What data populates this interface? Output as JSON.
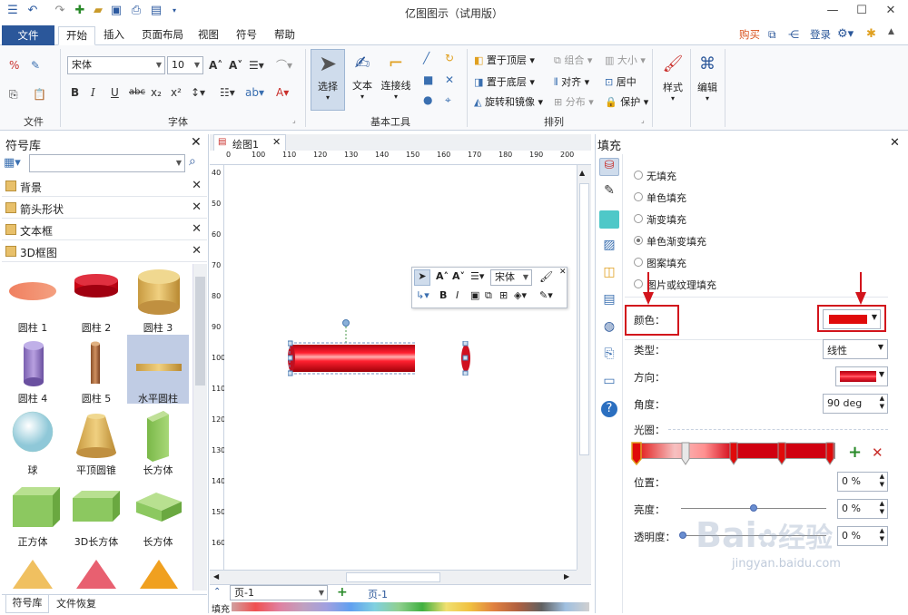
{
  "app": {
    "title": "亿图图示（试用版）"
  },
  "menu": {
    "file": "文件",
    "tabs": [
      "开始",
      "插入",
      "页面布局",
      "视图",
      "符号",
      "帮助"
    ],
    "buy": "购买",
    "login": "登录"
  },
  "ribbon": {
    "clipboard_label": "文件",
    "font_name": "宋体",
    "font_size": "10",
    "font_label": "字体",
    "tools": {
      "select": "选择",
      "text": "文本",
      "connector": "连接线",
      "label": "基本工具"
    },
    "arrange": {
      "bring_front": "置于顶层",
      "send_back": "置于底层",
      "rotate": "旋转和镜像",
      "group": "组合",
      "align": "对齐",
      "distribute": "分布",
      "size": "大小",
      "center": "居中",
      "protect": "保护",
      "label": "排列"
    },
    "style": "样式",
    "edit": "编辑"
  },
  "symlib": {
    "title": "符号库",
    "categories": [
      "背景",
      "箭头形状",
      "文本框",
      "3D框图"
    ],
    "shapes": [
      "圆柱 1",
      "圆柱 2",
      "圆柱 3",
      "圆柱 4",
      "圆柱 5",
      "水平圆柱",
      "球",
      "平顶圆锥",
      "长方体",
      "正方体",
      "3D长方体",
      "长方体"
    ],
    "footer_tabs": [
      "符号库",
      "文件恢复"
    ]
  },
  "canvas": {
    "tab": "绘图1",
    "hruler": [
      "100",
      "110",
      "120",
      "130",
      "140",
      "150",
      "160",
      "170",
      "180",
      "190",
      "200"
    ],
    "vruler": [
      "40",
      "50",
      "60",
      "70",
      "80",
      "90",
      "100",
      "110",
      "120",
      "130",
      "140",
      "150",
      "160"
    ],
    "page_select": "页-1",
    "page_tab": "页-1",
    "fill_label": "填充"
  },
  "minitoolbar": {
    "font": "宋体"
  },
  "fill": {
    "title": "填充",
    "options": [
      {
        "label": "无填充",
        "on": false
      },
      {
        "label": "单色填充",
        "on": false
      },
      {
        "label": "渐变填充",
        "on": false
      },
      {
        "label": "单色渐变填充",
        "on": true
      },
      {
        "label": "图案填充",
        "on": false
      },
      {
        "label": "图片或纹理填充",
        "on": false
      }
    ],
    "color_label": "颜色：",
    "type_label": "类型：",
    "type_value": "线性",
    "direction_label": "方向：",
    "angle_label": "角度：",
    "angle_value": "90 deg",
    "stops_label": "光圈：",
    "position_label": "位置：",
    "position_value": "0 %",
    "brightness_label": "亮度：",
    "brightness_value": "0 %",
    "brightness_level": 0.5,
    "transparency_label": "透明度：",
    "transparency_value": "0 %",
    "transparency_level": 0,
    "accent": "#e00a0a"
  },
  "watermark": {
    "line1": "Bai",
    "line2": "经验",
    "url": "jingyan.baidu.com"
  }
}
